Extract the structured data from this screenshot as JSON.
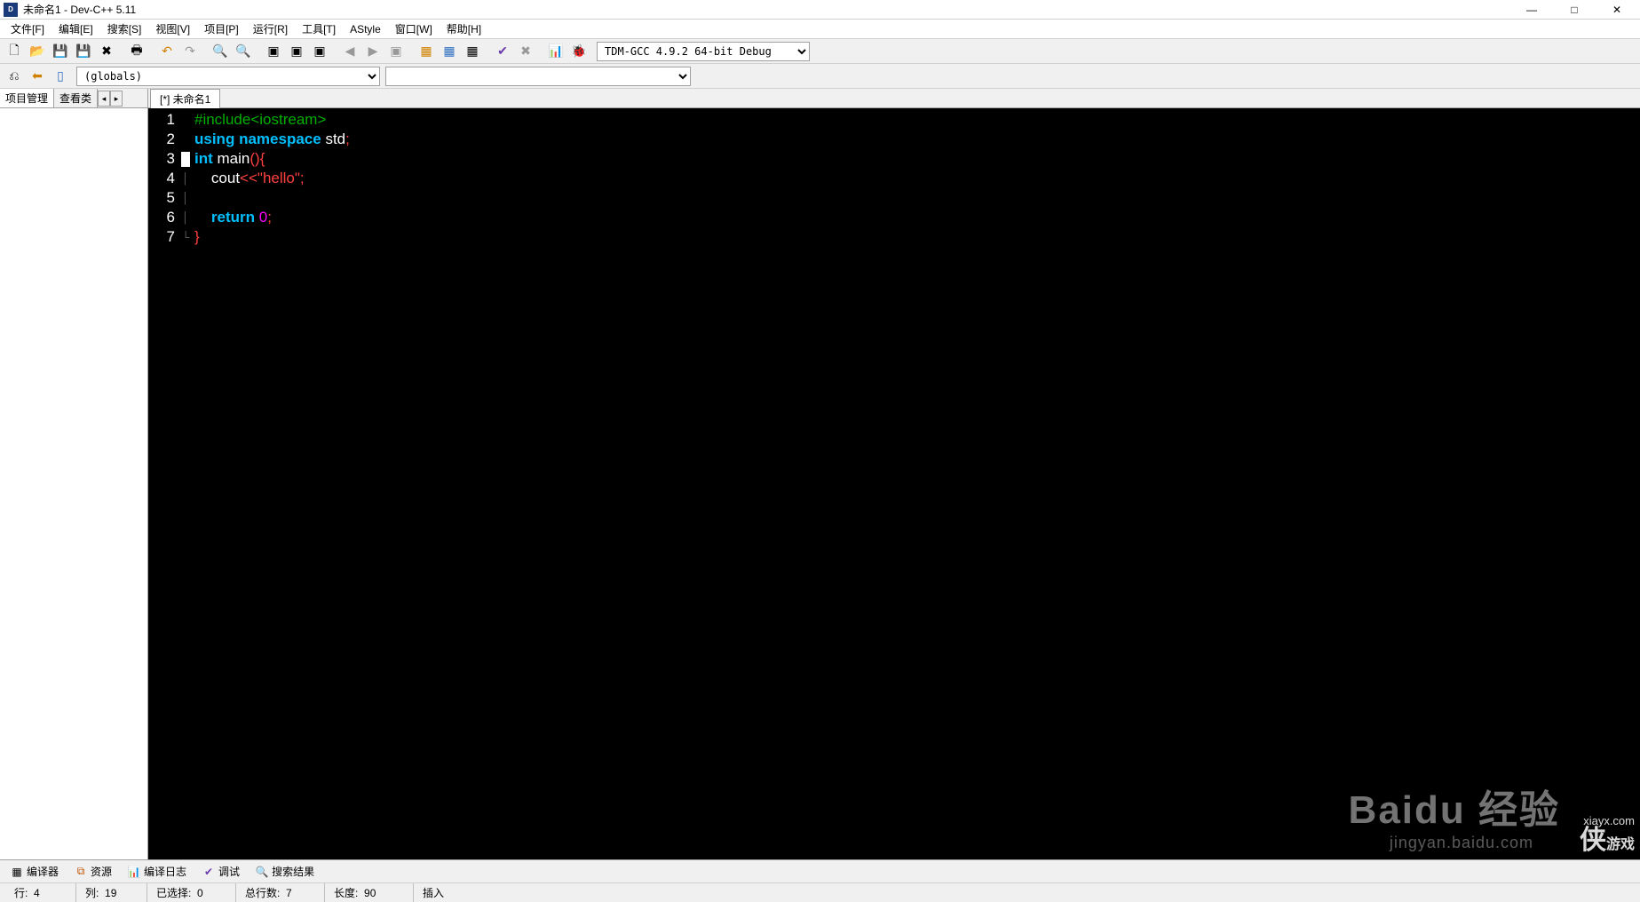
{
  "title": "未命名1 - Dev-C++ 5.11",
  "menu": {
    "file": "文件[F]",
    "edit": "编辑[E]",
    "search": "搜索[S]",
    "view": "视图[V]",
    "project": "项目[P]",
    "run": "运行[R]",
    "tools": "工具[T]",
    "astyle": "AStyle",
    "window": "窗口[W]",
    "help": "帮助[H]"
  },
  "toolbar": {
    "compiler": "TDM-GCC 4.9.2 64-bit Debug"
  },
  "scope_select": "(globals)",
  "side_tabs": {
    "project": "项目管理",
    "view_class": "查看类"
  },
  "editor_tab": "[*] 未命名1",
  "code": {
    "l1_include": "#include<iostream>",
    "l2_using": "using",
    "l2_namespace": "namespace",
    "l2_std": "std",
    "l2_semi": ";",
    "l3_int": "int",
    "l3_main": "main",
    "l3_paren": "()",
    "l3_brace": "{",
    "l4_cout": "cout",
    "l4_op": "<<",
    "l4_str": "\"hello\"",
    "l4_semi": ";",
    "l6_return": "return",
    "l6_zero": "0",
    "l6_semi": ";",
    "l7_brace": "}"
  },
  "line_numbers": [
    "1",
    "2",
    "3",
    "4",
    "5",
    "6",
    "7"
  ],
  "bottom_tabs": {
    "compiler": "编译器",
    "resource": "资源",
    "compile_log": "编译日志",
    "debug": "调试",
    "search_results": "搜索结果"
  },
  "status": {
    "row_label": "行:",
    "row_value": "4",
    "col_label": "列:",
    "col_value": "19",
    "sel_label": "已选择:",
    "sel_value": "0",
    "total_label": "总行数:",
    "total_value": "7",
    "len_label": "长度:",
    "len_value": "90",
    "mode": "插入"
  },
  "watermark": {
    "baidu": "Baidu 经验",
    "baidu_url": "jingyan.baidu.com",
    "xia_big": "侠",
    "xia_small": "xiayx.com",
    "xia_game": "游戏"
  }
}
